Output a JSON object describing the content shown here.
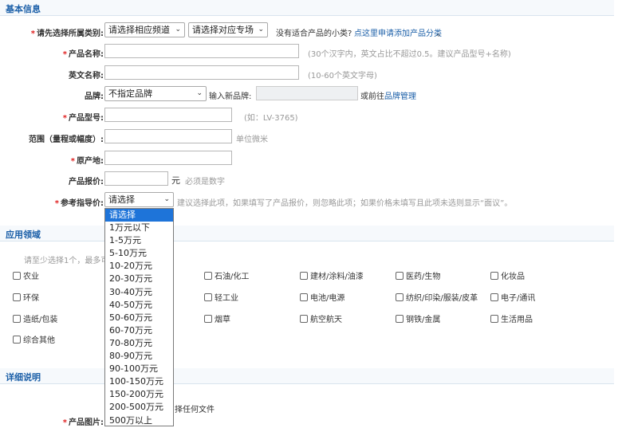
{
  "sections": {
    "basic": "基本信息",
    "application": "应用领域",
    "detail": "详细说明"
  },
  "fields": {
    "category_label": "请先选择所属类别:",
    "channel_select": "请选择相应频道",
    "topic_select": "请选择对应专场",
    "no_category_text": "没有适合产品的小类?",
    "add_category_link": "点这里申请添加产品分类",
    "period": "。",
    "product_name_label": "产品名称:",
    "product_name_hint": "(30个汉字内，英文占比不超过0.5。建议产品型号+名称)",
    "english_name_label": "英文名称:",
    "english_name_hint": "(10-60个英文字母)",
    "brand_label": "品牌:",
    "brand_select": "不指定品牌",
    "new_brand_label": "输入新品牌:",
    "brand_manage_prefix": "或前往",
    "brand_manage_link": "品牌管理",
    "model_label": "产品型号:",
    "model_hint": "(如：LV-3765)",
    "range_label": "范围（量程或幅度）:",
    "range_unit": "单位微米",
    "origin_label": "原产地:",
    "price_label": "产品报价:",
    "price_unit": "元",
    "price_hint": "必须是数字",
    "ref_price_label": "参考指导价:",
    "ref_price_select": "请选择",
    "ref_price_hint": "建议选择此项，如果填写了产品报价，则忽略此项；如果价格未填写且此项未选则显示“面议”。"
  },
  "application": {
    "hint": "请至少选择1个，最多可",
    "items": [
      "农业",
      "石油/化工",
      "建材/涂料/油漆",
      "医药/生物",
      "化妆品",
      "环保",
      "轻工业",
      "电池/电源",
      "纺织/印染/服装/皮革",
      "电子/通讯",
      "造纸/包装",
      "烟草",
      "航空航天",
      "钢铁/金属",
      "生活用品",
      "综合其他"
    ]
  },
  "detail": {
    "file_text": "择任何文件",
    "image_label": "产品图片:"
  },
  "dropdown": {
    "options": [
      "请选择",
      "1万元以下",
      "1-5万元",
      "5-10万元",
      "10-20万元",
      "20-30万元",
      "30-40万元",
      "40-50万元",
      "50-60万元",
      "60-70万元",
      "70-80万元",
      "80-90万元",
      "90-100万元",
      "100-150万元",
      "150-200万元",
      "200-500万元",
      "500万以上"
    ],
    "selected_index": 0
  }
}
